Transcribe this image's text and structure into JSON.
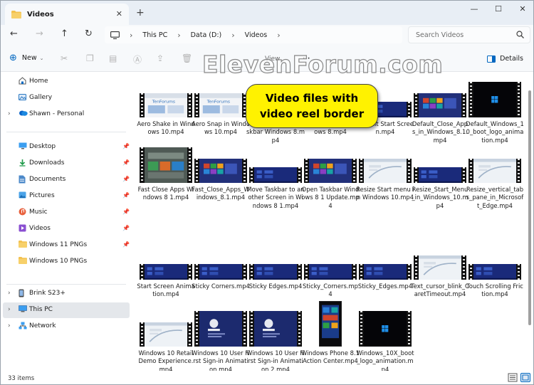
{
  "window": {
    "tab_title": "Videos",
    "new_tab": "+",
    "controls": {
      "minimize": "—",
      "maximize": "☐",
      "close": "✕"
    }
  },
  "address": {
    "crumbs": [
      "This PC",
      "Data (D:)",
      "Videos"
    ],
    "search_placeholder": "Search Videos"
  },
  "command_bar": {
    "new_label": "New",
    "view_label": "View",
    "more_label": "···",
    "details_label": "Details"
  },
  "watermark": "ElevenForum.com",
  "callout": {
    "line1": "Video files with",
    "line2": "video reel border"
  },
  "sidebar": {
    "top": [
      {
        "label": "Home",
        "icon": "home-icon"
      },
      {
        "label": "Gallery",
        "icon": "gallery-icon"
      },
      {
        "label": "Shawn - Personal",
        "icon": "onedrive-icon"
      }
    ],
    "quick": [
      {
        "label": "Desktop",
        "icon": "desktop-icon"
      },
      {
        "label": "Downloads",
        "icon": "downloads-icon"
      },
      {
        "label": "Documents",
        "icon": "documents-icon"
      },
      {
        "label": "Pictures",
        "icon": "pictures-icon"
      },
      {
        "label": "Music",
        "icon": "music-icon"
      },
      {
        "label": "Videos",
        "icon": "videos-icon"
      },
      {
        "label": "Windows 11 PNGs",
        "icon": "folder-icon"
      },
      {
        "label": "Windows 10 PNGs",
        "icon": "folder-icon"
      }
    ],
    "devices": [
      {
        "label": "Brink S23+",
        "icon": "phone-icon"
      },
      {
        "label": "This PC",
        "icon": "pc-icon"
      },
      {
        "label": "Network",
        "icon": "network-icon"
      }
    ]
  },
  "files": [
    {
      "name": "Aero Shake in Windows 10.mp4",
      "theme": "tenforums"
    },
    {
      "name": "Aero Snap in Windows 10.mp4",
      "theme": "tenforums"
    },
    {
      "name": "Move Taskbar in Taskbar Windows 8.mp4",
      "theme": "blue"
    },
    {
      "name": "Mark Taskbar Windows 8.mp4",
      "theme": "blue"
    },
    {
      "name": "Default Start Screen.mp4",
      "theme": "blue"
    },
    {
      "name": "Default_Close_Apps_in_Windows_8.1.mp4",
      "theme": "win8"
    },
    {
      "name": "Default_Windows_10_boot_logo_animation.mp4",
      "theme": "boot"
    },
    {
      "name": "Fast Close Apps Windows 8 1.mp4",
      "theme": "green"
    },
    {
      "name": "Fast_Close_Apps_Windows_8.1.mp4",
      "theme": "win8"
    },
    {
      "name": "Move Taskbar to another Screen in Windows 8 1.mp4",
      "theme": "blue"
    },
    {
      "name": "Open Taskbar Windows 8 1 Update.mp4",
      "theme": "win8"
    },
    {
      "name": "Resize Start menu in Windows 10.mp4",
      "theme": "white"
    },
    {
      "name": "Resize_Start_Menu_in_Windows_10.mp4",
      "theme": "blue"
    },
    {
      "name": "Resize_vertical_tabs_pane_in_Microsoft_Edge.mp4",
      "theme": "white"
    },
    {
      "name": "Start Screen Animation.mp4",
      "theme": "blue"
    },
    {
      "name": "Sticky Corners.mp4",
      "theme": "blue"
    },
    {
      "name": "Sticky Edges.mp4",
      "theme": "blue"
    },
    {
      "name": "Sticky_Corners.mp4",
      "theme": "blue"
    },
    {
      "name": "Sticky_Edges.mp4",
      "theme": "blue"
    },
    {
      "name": "Text_cursor_blink_CaretTimeout.mp4",
      "theme": "white"
    },
    {
      "name": "Touch Scrolling Friction.mp4",
      "theme": "blue"
    },
    {
      "name": "Windows 10 Retail Demo Experience.mp4",
      "theme": "white"
    },
    {
      "name": "Windows 10 User First Sign-in Animation.mp4",
      "theme": "signin"
    },
    {
      "name": "Windows 10 User First Sign-in Animation 2.mp4",
      "theme": "signin"
    },
    {
      "name": "Windows Phone 8.1 Action Center.mp4",
      "theme": "phone"
    },
    {
      "name": "Windows_10X_boot_logo_animation.mp4",
      "theme": "boot"
    }
  ],
  "status": {
    "count": "33 items"
  },
  "colors": {
    "titlebar": "#e8eef5",
    "accent": "#0067c0",
    "callout": "#fff200",
    "folder": "#f2c14e"
  }
}
